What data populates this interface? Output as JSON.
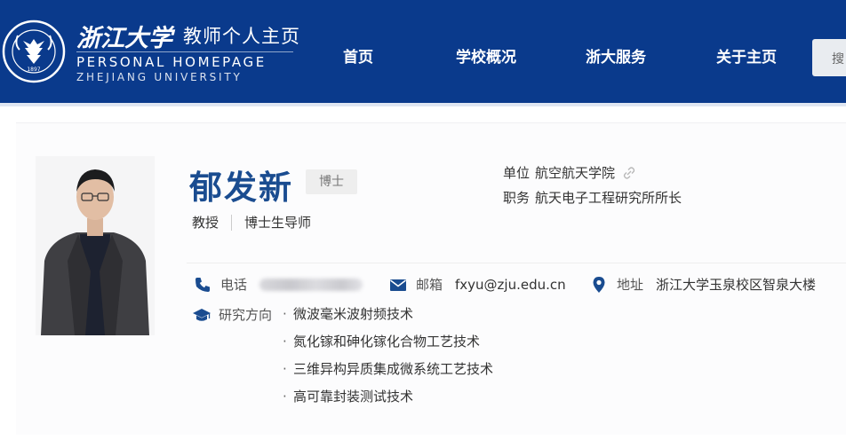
{
  "header": {
    "university_cn": "浙江大学",
    "subtitle_cn": "教师个人主页",
    "subtitle_en": "PERSONAL HOMEPAGE",
    "university_en": "ZHEJIANG UNIVERSITY",
    "logo": {
      "icon": "zju-emblem-icon",
      "year": "1897",
      "ring_text": "ZHEJIANG UNIVERSITY"
    },
    "nav": [
      {
        "label": "首页"
      },
      {
        "label": "学校概况"
      },
      {
        "label": "浙大服务"
      },
      {
        "label": "关于主页"
      }
    ],
    "search_label": "搜"
  },
  "profile": {
    "name": "郁发新",
    "degree": "博士",
    "title": "教授",
    "supervisor": "博士生导师",
    "unit_label": "单位",
    "unit_value": "航空航天学院",
    "position_label": "职务",
    "position_value": "航天电子工程研究所所长",
    "phone_label": "电话",
    "email_label": "邮箱",
    "email_value": "fxyu@zju.edu.cn",
    "address_label": "地址",
    "address_value": "浙江大学玉泉校区智泉大楼",
    "research_label": "研究方向",
    "research": [
      "微波毫米波射频技术",
      "氮化镓和砷化镓化合物工艺技术",
      "三维异构异质集成微系统工艺技术",
      "高可靠封装测试技术"
    ]
  },
  "colors": {
    "header_bg": "#0a3a8c",
    "name": "#1a4c90",
    "icon": "#1a4c90"
  }
}
